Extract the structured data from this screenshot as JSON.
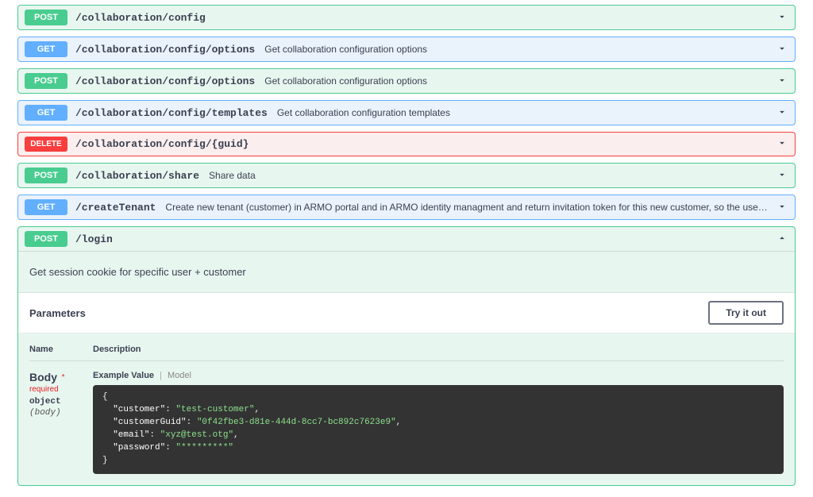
{
  "endpoints": [
    {
      "method": "POST",
      "mclass": "m-post",
      "eclass": "ep-post",
      "path": "/collaboration/config",
      "desc": ""
    },
    {
      "method": "GET",
      "mclass": "m-get",
      "eclass": "ep-get",
      "path": "/collaboration/config/options",
      "desc": "Get collaboration configuration options"
    },
    {
      "method": "POST",
      "mclass": "m-post",
      "eclass": "ep-post",
      "path": "/collaboration/config/options",
      "desc": "Get collaboration configuration options"
    },
    {
      "method": "GET",
      "mclass": "m-get",
      "eclass": "ep-get",
      "path": "/collaboration/config/templates",
      "desc": "Get collaboration configuration templates"
    },
    {
      "method": "DELETE",
      "mclass": "m-delete",
      "eclass": "ep-delete",
      "path": "/collaboration/config/{guid}",
      "desc": ""
    },
    {
      "method": "POST",
      "mclass": "m-post",
      "eclass": "ep-post",
      "path": "/collaboration/share",
      "desc": "Share data"
    },
    {
      "method": "GET",
      "mclass": "m-get",
      "eclass": "ep-get",
      "path": "/createTenant",
      "desc": "Create new tenant (customer) in ARMO portal and in ARMO identity managment and return invitation token for this new customer, so the user will be able to join it"
    }
  ],
  "login": {
    "method": "POST",
    "path": "/login",
    "description": "Get session cookie for specific user + customer",
    "parameters_label": "Parameters",
    "tryit_label": "Try it out",
    "col_name": "Name",
    "col_desc": "Description",
    "param_name": "Body",
    "required_label": "* required",
    "param_type": "object",
    "param_in": "(body)",
    "tab_example": "Example Value",
    "tab_model": "Model",
    "example": {
      "customer": "test-customer",
      "customerGuid": "0f42fbe3-d81e-444d-8cc7-bc892c7623e9",
      "email": "xyz@test.otg",
      "password": "*********"
    }
  }
}
